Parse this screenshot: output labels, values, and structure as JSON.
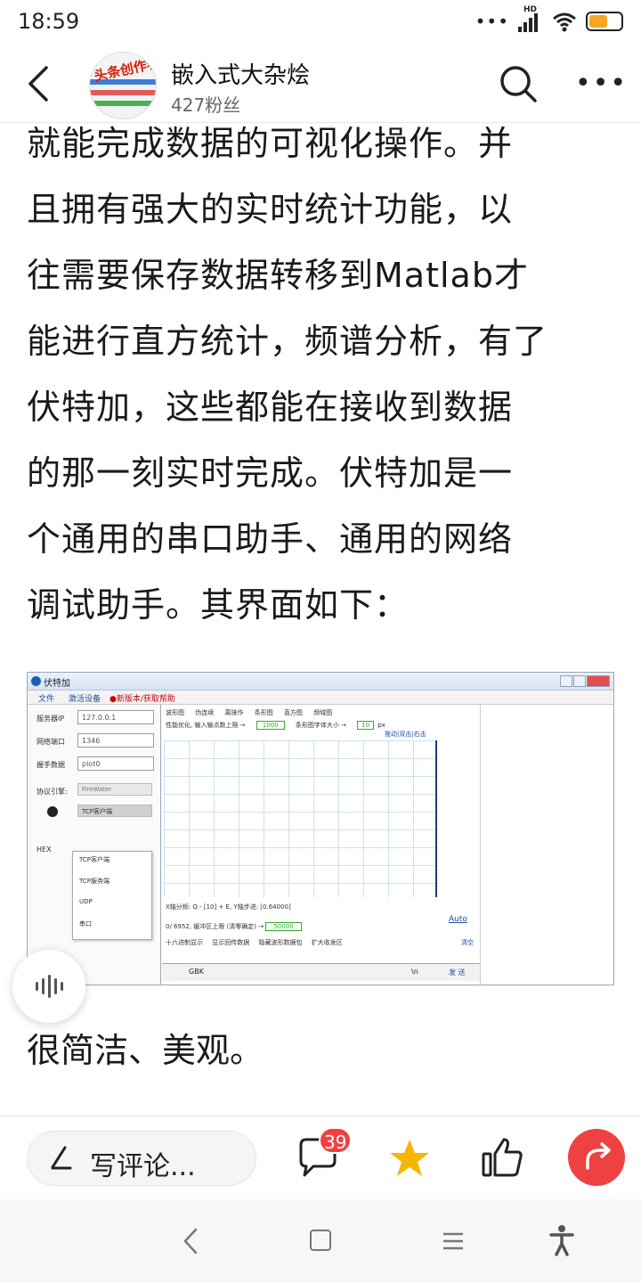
{
  "status_bar": {
    "time": "18:59",
    "network_label": "HD",
    "battery_color": "#f5a623"
  },
  "header": {
    "account_name": "嵌入式大杂烩",
    "fans": "427粉丝",
    "avatar_text": "头条创作者",
    "icons": [
      "back-arrow-icon",
      "search-icon",
      "more-icon"
    ]
  },
  "article": {
    "lines": [
      "就能完成数据的可视化操作。并",
      "且拥有强大的实时统计功能，以",
      "往需要保存数据转移到Matlab才",
      "能进行直方统计，频谱分析，有了",
      "伏特加，这些都能在接收到数据",
      "的那一刻实时完成。伏特加是一",
      "个通用的串口助手、通用的网络",
      "调试助手。其界面如下："
    ],
    "closing": "很简洁、美观。"
  },
  "figure": {
    "window_title": "伏特加",
    "menu": [
      "文件",
      "激活设备",
      "●新版本/获取帮助"
    ],
    "left_panel": {
      "server_ip_label": "服务器IP",
      "server_ip_value": "127.0.0.1",
      "port_label": "网络端口",
      "port_value": "1346",
      "handshake_label": "握手数据",
      "handshake_value": "plot0",
      "engine_label": "协议引擎:",
      "engine_value": "FireWater",
      "mode_value": "TCP客户端",
      "hex_label": "HEX",
      "dropdown_options": [
        "TCP客户端",
        "TCP服务端",
        "UDP",
        "串口"
      ]
    },
    "plot_panel": {
      "checkboxes": [
        "波形图",
        "伪连续",
        "离操作",
        "条形图",
        "直方图",
        "频域图"
      ],
      "perf_label": "性能优化, 输入输点数上限 →",
      "perf_value": "1000",
      "font_label": "条形图字体大小 →",
      "font_value": "10",
      "font_unit": "px",
      "links": "拖动|双击|右击",
      "axis_info": "X轴分频: Q - [10] + E,  Y轴步进: [0.64000]",
      "buffer_label": "0/ 6952, 缓冲区上限 (清零确定) →",
      "buffer_value": "50000",
      "auto_label": "Auto",
      "options": [
        "十六进制显示",
        "显示回传数据",
        "隐藏波形数据包",
        "扩大收发区"
      ],
      "clear_label": "清空",
      "encoding": "GBK",
      "newline": "\\n",
      "send_label": "发 送"
    }
  },
  "action_bar": {
    "comment_placeholder": "写评论...",
    "comment_count": "39",
    "accent": "#f04142",
    "star_color": "#f7b500"
  },
  "nav_bar": {
    "icons": [
      "nav-back-icon",
      "nav-home-icon",
      "nav-menu-icon",
      "accessibility-icon"
    ]
  }
}
